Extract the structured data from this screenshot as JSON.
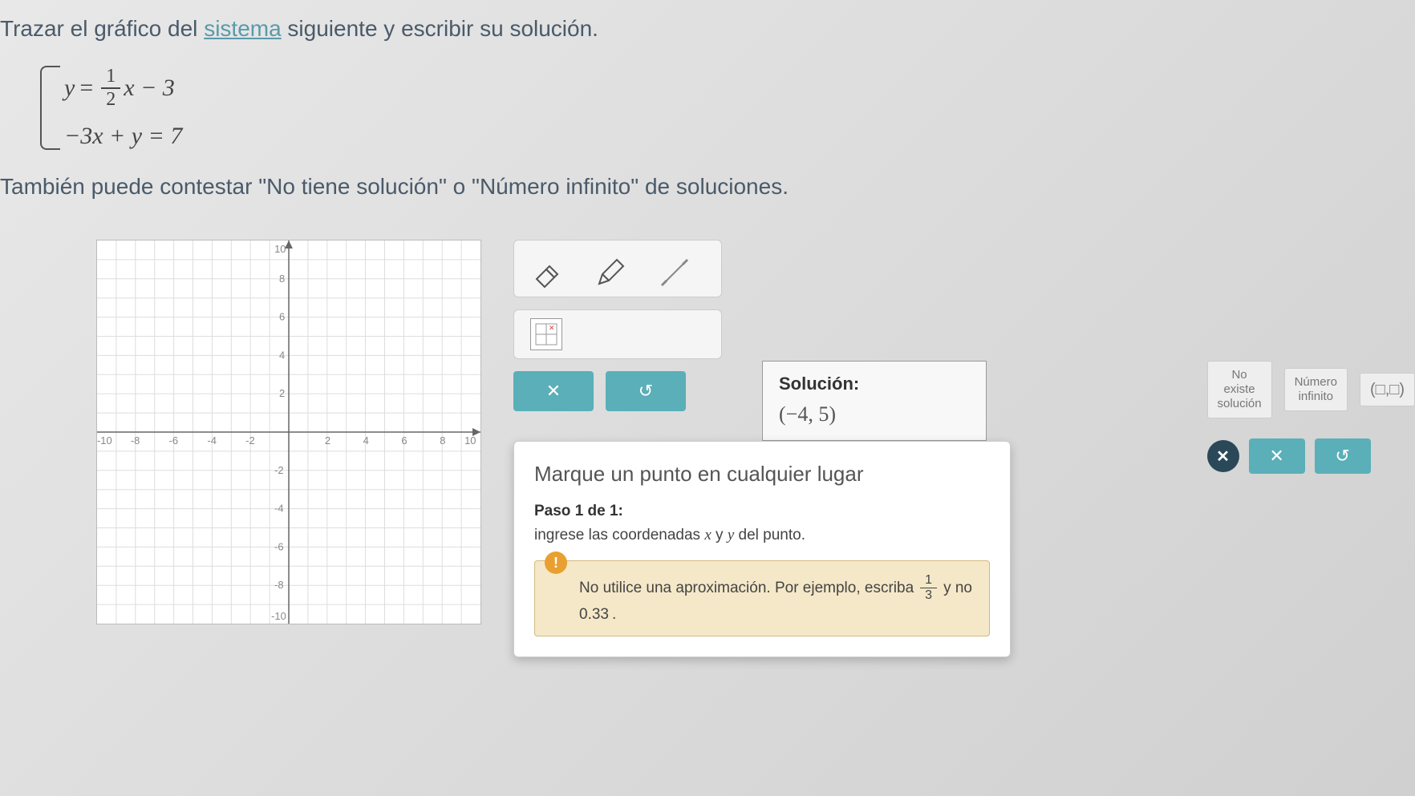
{
  "problem": {
    "text_before": "Trazar el gráfico del ",
    "link_word": "sistema",
    "text_after": " siguiente y escribir su solución."
  },
  "equations": {
    "eq1_lhs": "y",
    "eq1_frac_num": "1",
    "eq1_frac_den": "2",
    "eq1_rest": "x − 3",
    "eq2": "−3x + y = 7"
  },
  "subtext": "También puede contestar \"No tiene solución\" o \"Número infinito\" de soluciones.",
  "graph": {
    "xmin": -10,
    "xmax": 10,
    "ymin": -10,
    "ymax": 10,
    "xticks": [
      -10,
      -8,
      -6,
      -4,
      -2,
      2,
      4,
      6,
      8,
      10
    ],
    "yticks": [
      -10,
      -8,
      -6,
      -4,
      -2,
      2,
      4,
      6,
      8,
      10
    ]
  },
  "tools": {
    "eraser": "eraser-icon",
    "pencil": "pencil-icon",
    "line": "line-icon",
    "grid": "grid-icon"
  },
  "buttons": {
    "clear": "✕",
    "undo": "↺",
    "close": "✕"
  },
  "solution": {
    "label": "Solución:",
    "value": "(−4, 5)"
  },
  "options": {
    "no_solution_line1": "No",
    "no_solution_line2": "existe",
    "no_solution_line3": "solución",
    "infinite_line1": "Número",
    "infinite_line2": "infinito",
    "ordered_pair": "(□,□)"
  },
  "tooltip": {
    "title": "Marque un punto en cualquier lugar",
    "step_label": "Paso 1 de 1:",
    "instruction_before": "ingrese las coordenadas ",
    "instruction_x": "x",
    "instruction_mid": " y ",
    "instruction_y": "y",
    "instruction_after": " del punto.",
    "warning_before": "No utilice una aproximación. Por ejemplo, escriba ",
    "warning_frac_num": "1",
    "warning_frac_den": "3",
    "warning_mid": " y no ",
    "warning_value": "0.33",
    "warning_after": "."
  }
}
